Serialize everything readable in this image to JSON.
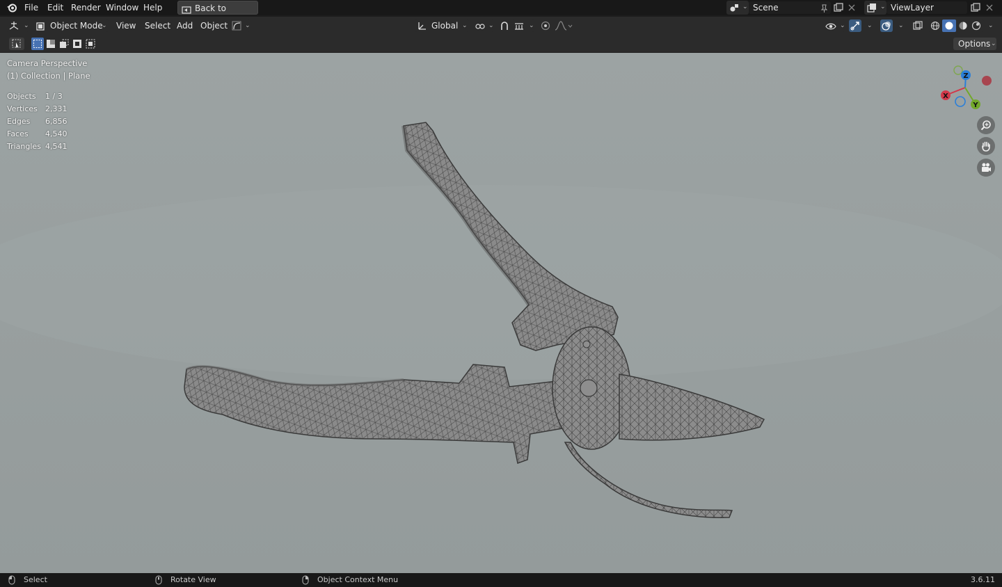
{
  "topbar": {
    "menus": [
      "File",
      "Edit",
      "Render",
      "Window",
      "Help"
    ],
    "back_button": "Back to Previous",
    "scene_name": "Scene",
    "view_layer": "ViewLayer"
  },
  "header": {
    "mode": "Object Mode",
    "menus": [
      "View",
      "Select",
      "Add",
      "Object"
    ],
    "transform_orientation": "Global"
  },
  "toolrow": {
    "options_label": "Options"
  },
  "viewport": {
    "view_name": "Camera Perspective",
    "collection_info": "(1) Collection | Plane",
    "stats": [
      {
        "label": "Objects",
        "value": "1 / 3"
      },
      {
        "label": "Vertices",
        "value": "2,331"
      },
      {
        "label": "Edges",
        "value": "6,856"
      },
      {
        "label": "Faces",
        "value": "4,540"
      },
      {
        "label": "Triangles",
        "value": "4,541"
      }
    ],
    "gizmo": {
      "z": "Z",
      "x": "X",
      "y": "Y"
    }
  },
  "statusbar": {
    "select": "Select",
    "rotate": "Rotate View",
    "context": "Object Context Menu",
    "version": "3.6.11"
  },
  "colors": {
    "viewport_bg": "#98a0a0",
    "axis_x": "#d2384a",
    "axis_y": "#72a82a",
    "axis_z": "#2b7fd8",
    "mesh_fill": "#8a8a8a",
    "wire": "#3a3a3a"
  }
}
